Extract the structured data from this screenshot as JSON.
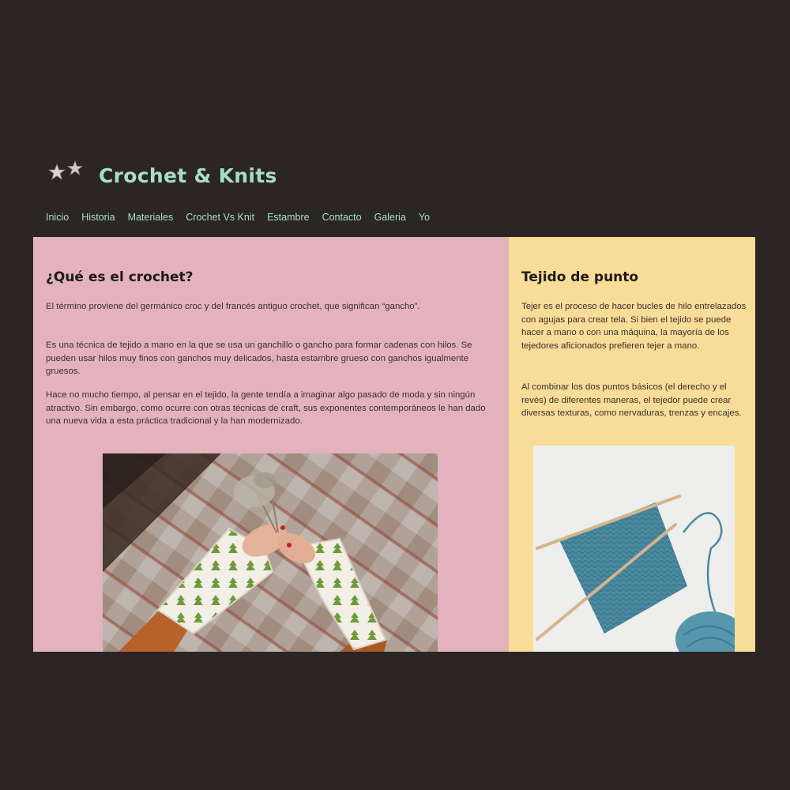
{
  "header": {
    "logo_icon": "stars-icon",
    "title": "Crochet & Knits"
  },
  "nav": {
    "items": [
      {
        "label": "Inicio"
      },
      {
        "label": "Historia"
      },
      {
        "label": "Materiales"
      },
      {
        "label": "Crochet Vs Knit"
      },
      {
        "label": "Estambre"
      },
      {
        "label": "Contacto"
      },
      {
        "label": "Galeria"
      },
      {
        "label": "Yo"
      }
    ]
  },
  "main": {
    "heading": "¿Qué es el crochet?",
    "paragraphs": [
      "El término proviene del germánico croc y del francés antiguo crochet, que significan “gancho”.",
      "Es una técnica de tejido a mano en la que se usa un ganchillo o gancho para formar cadenas con hilos. Se pueden usar hilos muy finos con ganchos muy delicados, hasta estambre grueso con ganchos igualmente gruesos.",
      "Hace no mucho tiempo, al pensar en el tejido, la gente tendía a imaginar algo pasado de moda y sin ningún atractivo. Sin embargo, como ocurre con otras técnicas de craft, sus exponentes contemporáneos le han dado una nueva vida a esta práctica tradicional y la han modernizado."
    ],
    "image_icon": "crochet-mittens-photo"
  },
  "sidebar": {
    "heading": "Tejido de punto",
    "paragraphs": [
      "Tejer es el proceso de hacer bucles de hilo entrelazados con agujas para crear tela. Si bien el tejido se puede hacer a mano o con una máquina, la mayoría de los tejedores aficionados prefieren tejer a mano.",
      "Al combinar los dos puntos básicos (el derecho y el revés) de diferentes maneras, el tejedor puede crear diversas texturas, como nervaduras, trenzas y encajes."
    ],
    "image_icon": "knitting-needles-photo"
  },
  "colors": {
    "background": "#2b2526",
    "accent": "#a8dfc4",
    "main_panel": "#e3b2bc",
    "side_panel": "#f8dc97"
  }
}
